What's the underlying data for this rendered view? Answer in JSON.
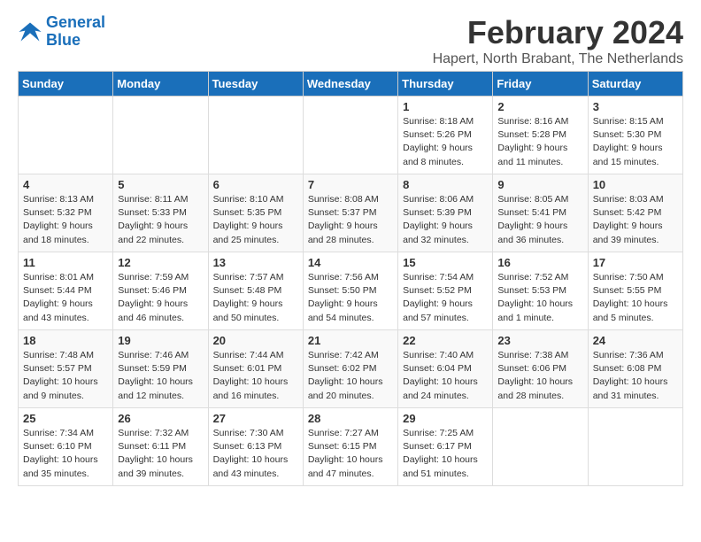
{
  "logo": {
    "line1": "General",
    "line2": "Blue"
  },
  "title": "February 2024",
  "location": "Hapert, North Brabant, The Netherlands",
  "days_of_week": [
    "Sunday",
    "Monday",
    "Tuesday",
    "Wednesday",
    "Thursday",
    "Friday",
    "Saturday"
  ],
  "weeks": [
    [
      {
        "day": "",
        "info": ""
      },
      {
        "day": "",
        "info": ""
      },
      {
        "day": "",
        "info": ""
      },
      {
        "day": "",
        "info": ""
      },
      {
        "day": "1",
        "info": "Sunrise: 8:18 AM\nSunset: 5:26 PM\nDaylight: 9 hours\nand 8 minutes."
      },
      {
        "day": "2",
        "info": "Sunrise: 8:16 AM\nSunset: 5:28 PM\nDaylight: 9 hours\nand 11 minutes."
      },
      {
        "day": "3",
        "info": "Sunrise: 8:15 AM\nSunset: 5:30 PM\nDaylight: 9 hours\nand 15 minutes."
      }
    ],
    [
      {
        "day": "4",
        "info": "Sunrise: 8:13 AM\nSunset: 5:32 PM\nDaylight: 9 hours\nand 18 minutes."
      },
      {
        "day": "5",
        "info": "Sunrise: 8:11 AM\nSunset: 5:33 PM\nDaylight: 9 hours\nand 22 minutes."
      },
      {
        "day": "6",
        "info": "Sunrise: 8:10 AM\nSunset: 5:35 PM\nDaylight: 9 hours\nand 25 minutes."
      },
      {
        "day": "7",
        "info": "Sunrise: 8:08 AM\nSunset: 5:37 PM\nDaylight: 9 hours\nand 28 minutes."
      },
      {
        "day": "8",
        "info": "Sunrise: 8:06 AM\nSunset: 5:39 PM\nDaylight: 9 hours\nand 32 minutes."
      },
      {
        "day": "9",
        "info": "Sunrise: 8:05 AM\nSunset: 5:41 PM\nDaylight: 9 hours\nand 36 minutes."
      },
      {
        "day": "10",
        "info": "Sunrise: 8:03 AM\nSunset: 5:42 PM\nDaylight: 9 hours\nand 39 minutes."
      }
    ],
    [
      {
        "day": "11",
        "info": "Sunrise: 8:01 AM\nSunset: 5:44 PM\nDaylight: 9 hours\nand 43 minutes."
      },
      {
        "day": "12",
        "info": "Sunrise: 7:59 AM\nSunset: 5:46 PM\nDaylight: 9 hours\nand 46 minutes."
      },
      {
        "day": "13",
        "info": "Sunrise: 7:57 AM\nSunset: 5:48 PM\nDaylight: 9 hours\nand 50 minutes."
      },
      {
        "day": "14",
        "info": "Sunrise: 7:56 AM\nSunset: 5:50 PM\nDaylight: 9 hours\nand 54 minutes."
      },
      {
        "day": "15",
        "info": "Sunrise: 7:54 AM\nSunset: 5:52 PM\nDaylight: 9 hours\nand 57 minutes."
      },
      {
        "day": "16",
        "info": "Sunrise: 7:52 AM\nSunset: 5:53 PM\nDaylight: 10 hours\nand 1 minute."
      },
      {
        "day": "17",
        "info": "Sunrise: 7:50 AM\nSunset: 5:55 PM\nDaylight: 10 hours\nand 5 minutes."
      }
    ],
    [
      {
        "day": "18",
        "info": "Sunrise: 7:48 AM\nSunset: 5:57 PM\nDaylight: 10 hours\nand 9 minutes."
      },
      {
        "day": "19",
        "info": "Sunrise: 7:46 AM\nSunset: 5:59 PM\nDaylight: 10 hours\nand 12 minutes."
      },
      {
        "day": "20",
        "info": "Sunrise: 7:44 AM\nSunset: 6:01 PM\nDaylight: 10 hours\nand 16 minutes."
      },
      {
        "day": "21",
        "info": "Sunrise: 7:42 AM\nSunset: 6:02 PM\nDaylight: 10 hours\nand 20 minutes."
      },
      {
        "day": "22",
        "info": "Sunrise: 7:40 AM\nSunset: 6:04 PM\nDaylight: 10 hours\nand 24 minutes."
      },
      {
        "day": "23",
        "info": "Sunrise: 7:38 AM\nSunset: 6:06 PM\nDaylight: 10 hours\nand 28 minutes."
      },
      {
        "day": "24",
        "info": "Sunrise: 7:36 AM\nSunset: 6:08 PM\nDaylight: 10 hours\nand 31 minutes."
      }
    ],
    [
      {
        "day": "25",
        "info": "Sunrise: 7:34 AM\nSunset: 6:10 PM\nDaylight: 10 hours\nand 35 minutes."
      },
      {
        "day": "26",
        "info": "Sunrise: 7:32 AM\nSunset: 6:11 PM\nDaylight: 10 hours\nand 39 minutes."
      },
      {
        "day": "27",
        "info": "Sunrise: 7:30 AM\nSunset: 6:13 PM\nDaylight: 10 hours\nand 43 minutes."
      },
      {
        "day": "28",
        "info": "Sunrise: 7:27 AM\nSunset: 6:15 PM\nDaylight: 10 hours\nand 47 minutes."
      },
      {
        "day": "29",
        "info": "Sunrise: 7:25 AM\nSunset: 6:17 PM\nDaylight: 10 hours\nand 51 minutes."
      },
      {
        "day": "",
        "info": ""
      },
      {
        "day": "",
        "info": ""
      }
    ]
  ]
}
